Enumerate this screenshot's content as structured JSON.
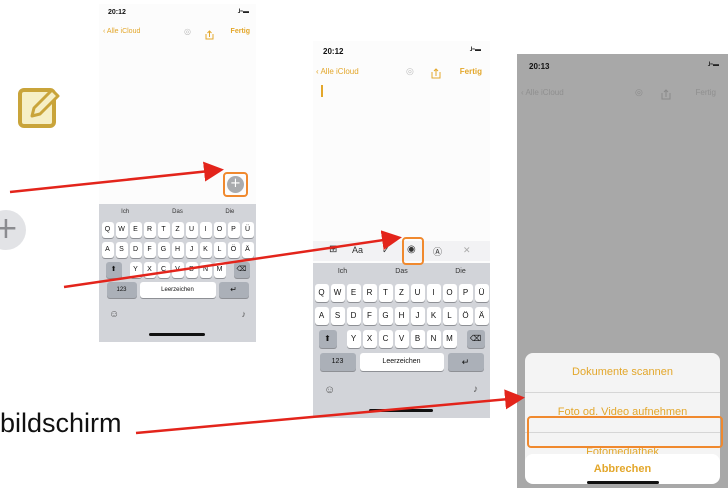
{
  "left": {
    "compose_icon": "compose-icon",
    "plus_icon": "plus-icon",
    "plus_glyph": "+",
    "partial_text": "bildschirm"
  },
  "phone1": {
    "time": "20:12",
    "signal": "..ll ≈ ▬",
    "back": "Alle iCloud",
    "done": "Fertig",
    "add_glyph": "+",
    "suggestions": [
      "Ich",
      "Das",
      "Die"
    ],
    "row1": [
      "Q",
      "W",
      "E",
      "R",
      "T",
      "Z",
      "U",
      "I",
      "O",
      "P",
      "Ü"
    ],
    "row2": [
      "A",
      "S",
      "D",
      "F",
      "G",
      "H",
      "J",
      "K",
      "L",
      "Ö",
      "Ä"
    ],
    "row3": [
      "Y",
      "X",
      "C",
      "V",
      "B",
      "N",
      "M"
    ],
    "shift_glyph": "⬆",
    "delete_glyph": "⌫",
    "num_key": "123",
    "space_key": "Leerzeichen",
    "return_glyph": "↵",
    "emoji_glyph": "☺",
    "mic_glyph": "♪"
  },
  "phone2": {
    "time": "20:12",
    "signal": "..ll ≈ ▬",
    "back": "Alle iCloud",
    "done": "Fertig",
    "toolbar": [
      "⊞",
      "Aa",
      "✓",
      "◉",
      "Ⓐ",
      "✕"
    ],
    "suggestions": [
      "Ich",
      "Das",
      "Die"
    ],
    "row1": [
      "Q",
      "W",
      "E",
      "R",
      "T",
      "Z",
      "U",
      "I",
      "O",
      "P",
      "Ü"
    ],
    "row2": [
      "A",
      "S",
      "D",
      "F",
      "G",
      "H",
      "J",
      "K",
      "L",
      "Ö",
      "Ä"
    ],
    "row3": [
      "Y",
      "X",
      "C",
      "V",
      "B",
      "N",
      "M"
    ],
    "shift_glyph": "⬆",
    "delete_glyph": "⌫",
    "num_key": "123",
    "space_key": "Leerzeichen",
    "return_glyph": "↵",
    "emoji_glyph": "☺",
    "mic_glyph": "♪"
  },
  "phone3": {
    "time": "20:13",
    "signal": "..ll ≈ ▬",
    "back": "Alle iCloud",
    "done": "Fertig",
    "actions": [
      "Dokumente scannen",
      "Foto od. Video aufnehmen",
      "Fotomediathek"
    ],
    "cancel": "Abbrechen"
  },
  "colors": {
    "accent": "#e3a72b",
    "highlight": "#f0892e",
    "arrow": "#e3241b",
    "keyboard_bg": "#d2d4d9"
  }
}
